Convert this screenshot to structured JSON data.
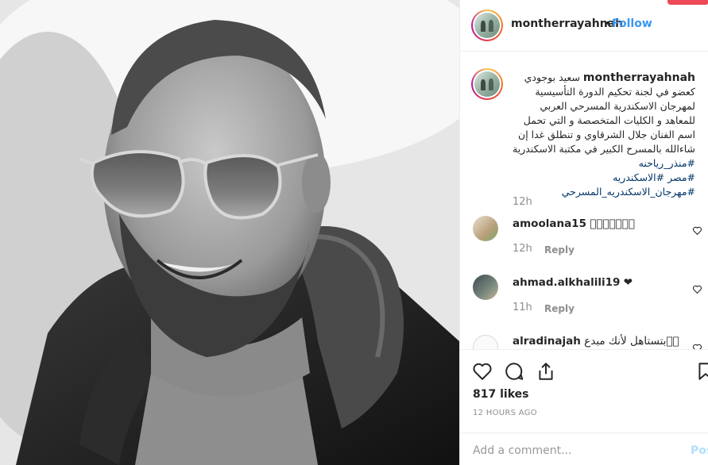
{
  "post": {
    "username": "montherrayahnah",
    "separator": "•",
    "follow_label": "Follow"
  },
  "caption": {
    "username": "montherrayahnah",
    "text": "سعيد بوجودي كعضو في لجنة تحكيم الدورة التأسيسية لمهرجان الاسكندرية المسرحي العربي للمعاهد و الكليات المتخصصة و التي تحمل اسم الفنان جلال الشرقاوي و تنطلق غدا إن شاءالله بالمسرح الكبير في مكتبة الاسكندرية",
    "tags": [
      "#منذر_رياحنه",
      "#مصر #الاسكندريه",
      "#مهرجان_الاسكندريه_المسرحي"
    ],
    "time": "12h"
  },
  "comments": [
    {
      "username": "amoolana15",
      "text": "􀀀􀀀􀀀􀀀􀀀􀀀􀀀",
      "time": "12h",
      "reply": "Reply"
    },
    {
      "username": "ahmad.alkhalili19",
      "text": "❤",
      "time": "11h",
      "reply": "Reply"
    },
    {
      "username": "alradinajah",
      "text": "بتستاهل لأنك مبدع􀀀􀀀",
      "time": "",
      "reply": ""
    }
  ],
  "icons": {
    "like": "heart-icon",
    "comment": "comment-bubble-icon",
    "share": "share-icon",
    "save": "bookmark-icon"
  },
  "likes_label": "817 likes",
  "ago_label": "12 HOURS AGO",
  "add_comment": {
    "placeholder": "Add a comment...",
    "post_label": "Post"
  },
  "colors": {
    "link": "#3897f0",
    "hashtag": "#003569",
    "muted": "#8e8e8e",
    "border": "#efefef"
  }
}
